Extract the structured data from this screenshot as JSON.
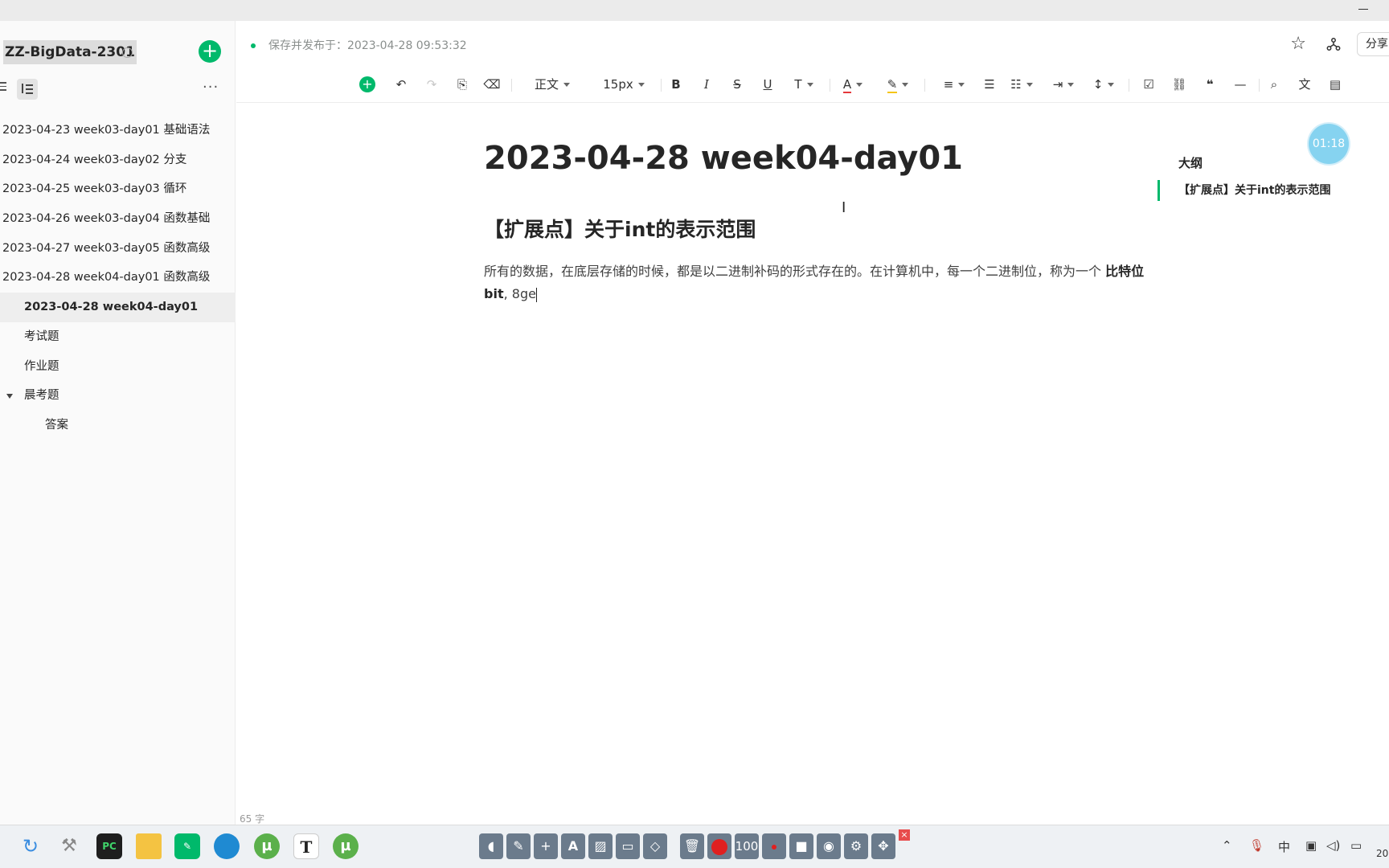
{
  "sidebar": {
    "kb_title": "ZZ-BigData-2301",
    "add_label": "+",
    "more_label": "···",
    "items": [
      {
        "label": "2023-04-23 week03-day01 基础语法"
      },
      {
        "label": "2023-04-24 week03-day02 分支"
      },
      {
        "label": "2023-04-25 week03-day03 循环"
      },
      {
        "label": "2023-04-26 week03-day04 函数基础"
      },
      {
        "label": "2023-04-27 week03-day05 函数高级"
      },
      {
        "label": "2023-04-28 week04-day01 函数高级"
      },
      {
        "label": "2023-04-28 week04-day01"
      },
      {
        "label": "考试题"
      },
      {
        "label": "作业题"
      },
      {
        "label": "晨考题"
      },
      {
        "label": "答案"
      }
    ]
  },
  "header": {
    "status": "保存并发布于：2023-04-28 09:53:32",
    "share_label": "分享"
  },
  "toolbar": {
    "style_label": "正文",
    "size_label": "15px",
    "bold": "B",
    "italic": "I",
    "strike": "S",
    "underline": "U",
    "font_color": "A"
  },
  "doc": {
    "title": "2023-04-28 week04-day01",
    "h2": "【扩展点】关于int的表示范围",
    "para_text": "所有的数据，在底层存储的时候，都是以二进制补码的形式存在的。在计算机中，每一个二进制位，称为一个 ",
    "para_bold": "比特位bit",
    "para_tail": ", 8ge"
  },
  "outline": {
    "label": "大纲",
    "item": "【扩展点】关于int的表示范围"
  },
  "timer": "01:18",
  "word_count": "65 字",
  "taskbar": {
    "t_label": "T",
    "rec_count": "100",
    "ime": "中",
    "clock_partial": "20"
  },
  "colors": {
    "accent": "#00b96b",
    "timer": "#86d3f0"
  }
}
